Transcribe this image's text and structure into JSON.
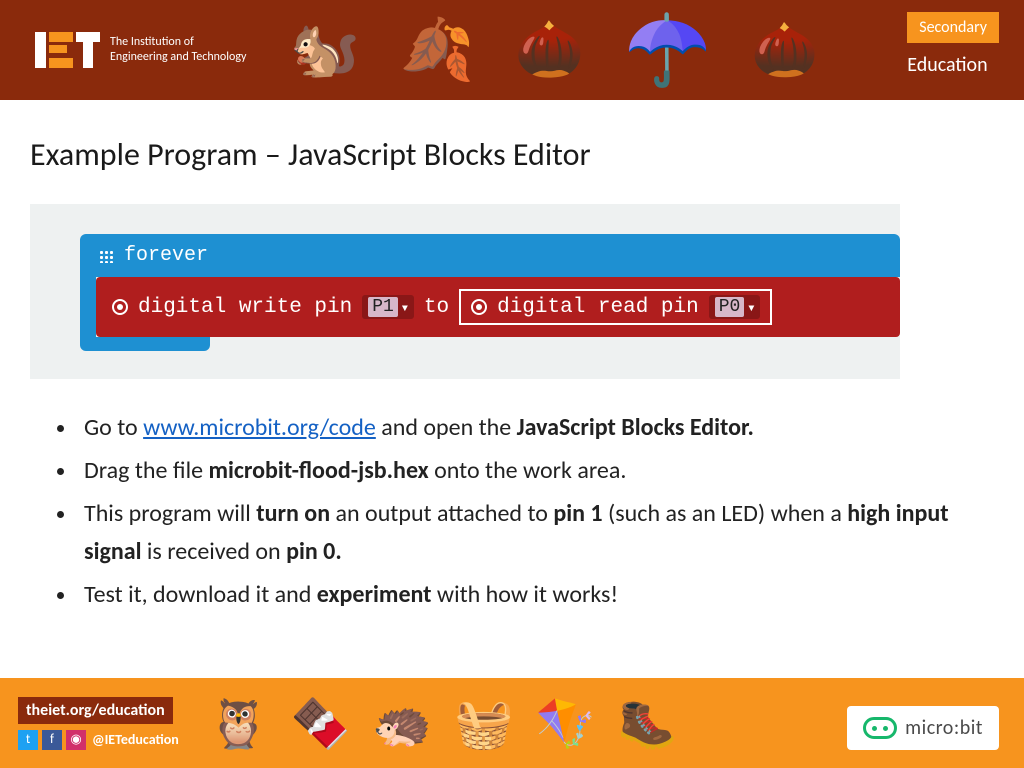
{
  "header": {
    "org_line1": "The Institution of",
    "org_line2": "Engineering and Technology",
    "badge": "Secondary",
    "edu": "Education"
  },
  "title": "Example Program – JavaScript Blocks Editor",
  "code": {
    "forever": "forever",
    "write_pre": "digital write pin",
    "write_pin": "P1",
    "to": "to",
    "read_pre": "digital read pin",
    "read_pin": "P0"
  },
  "bullets": {
    "b1_pre": "Go to ",
    "b1_link": "www.microbit.org/code",
    "b1_post": " and open the ",
    "b1_bold": "JavaScript Blocks Editor.",
    "b2_pre": "Drag the file ",
    "b2_bold": "microbit-flood-jsb.hex",
    "b2_post": " onto the work area.",
    "b3_a": "This program will ",
    "b3_b1": "turn on",
    "b3_b": " an output attached to ",
    "b3_b2": "pin 1",
    "b3_c": " (such as an LED) when a ",
    "b3_b3": "high input signal",
    "b3_d": " is received on ",
    "b3_b4": "pin 0.",
    "b4_a": "Test it, download it and ",
    "b4_b": "experiment",
    "b4_c": " with how it works!"
  },
  "footer": {
    "url": "theiet.org/education",
    "handle": "@IETeducation",
    "microbit": "micro:bit"
  }
}
